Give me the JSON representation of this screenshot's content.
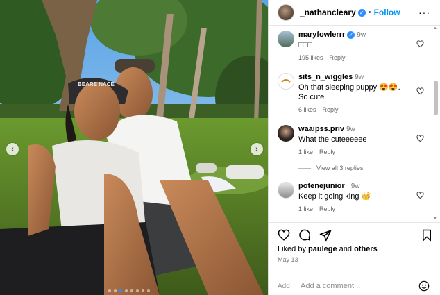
{
  "post": {
    "username": "_nathancleary",
    "verified_mark": "✓",
    "separator": "•",
    "follow_label": "Follow",
    "more_label": "···",
    "liked_by_prefix": "Liked by ",
    "liked_by_user": "paulege",
    "liked_by_and": " and ",
    "liked_by_others": "others",
    "date": "May 13",
    "cap_text": "BEARE NACE"
  },
  "carousel": {
    "prev_label": "‹",
    "next_label": "›",
    "slide_count": 8,
    "active_index": 2
  },
  "comments": [
    {
      "username": "maryfowlerrr",
      "verified": true,
      "time": "9w",
      "text": "□□□",
      "likes": "195 likes",
      "reply": "Reply"
    },
    {
      "username": "sits_n_wiggles",
      "verified": false,
      "time": "9w",
      "text": "Oh that sleeping puppy 😍😍. So cute",
      "likes": "6 likes",
      "reply": "Reply"
    },
    {
      "username": "waaipss.priv",
      "verified": false,
      "time": "9w",
      "text": "What the cuteeeeee",
      "likes": "1 like",
      "reply": "Reply",
      "view_replies": "View all 3 replies"
    },
    {
      "username": "potenejunior_",
      "verified": false,
      "time": "9w",
      "text": "Keep it going king 👑",
      "likes": "1 like",
      "reply": "Reply"
    }
  ],
  "add_comment": {
    "label": "Add",
    "placeholder": "Add a comment..."
  },
  "colors": {
    "accent": "#0095f6",
    "verified": "#2d8cff"
  },
  "icons": [
    "heart-icon",
    "comment-icon",
    "share-icon",
    "bookmark-icon",
    "emoji-icon",
    "more-icon"
  ]
}
